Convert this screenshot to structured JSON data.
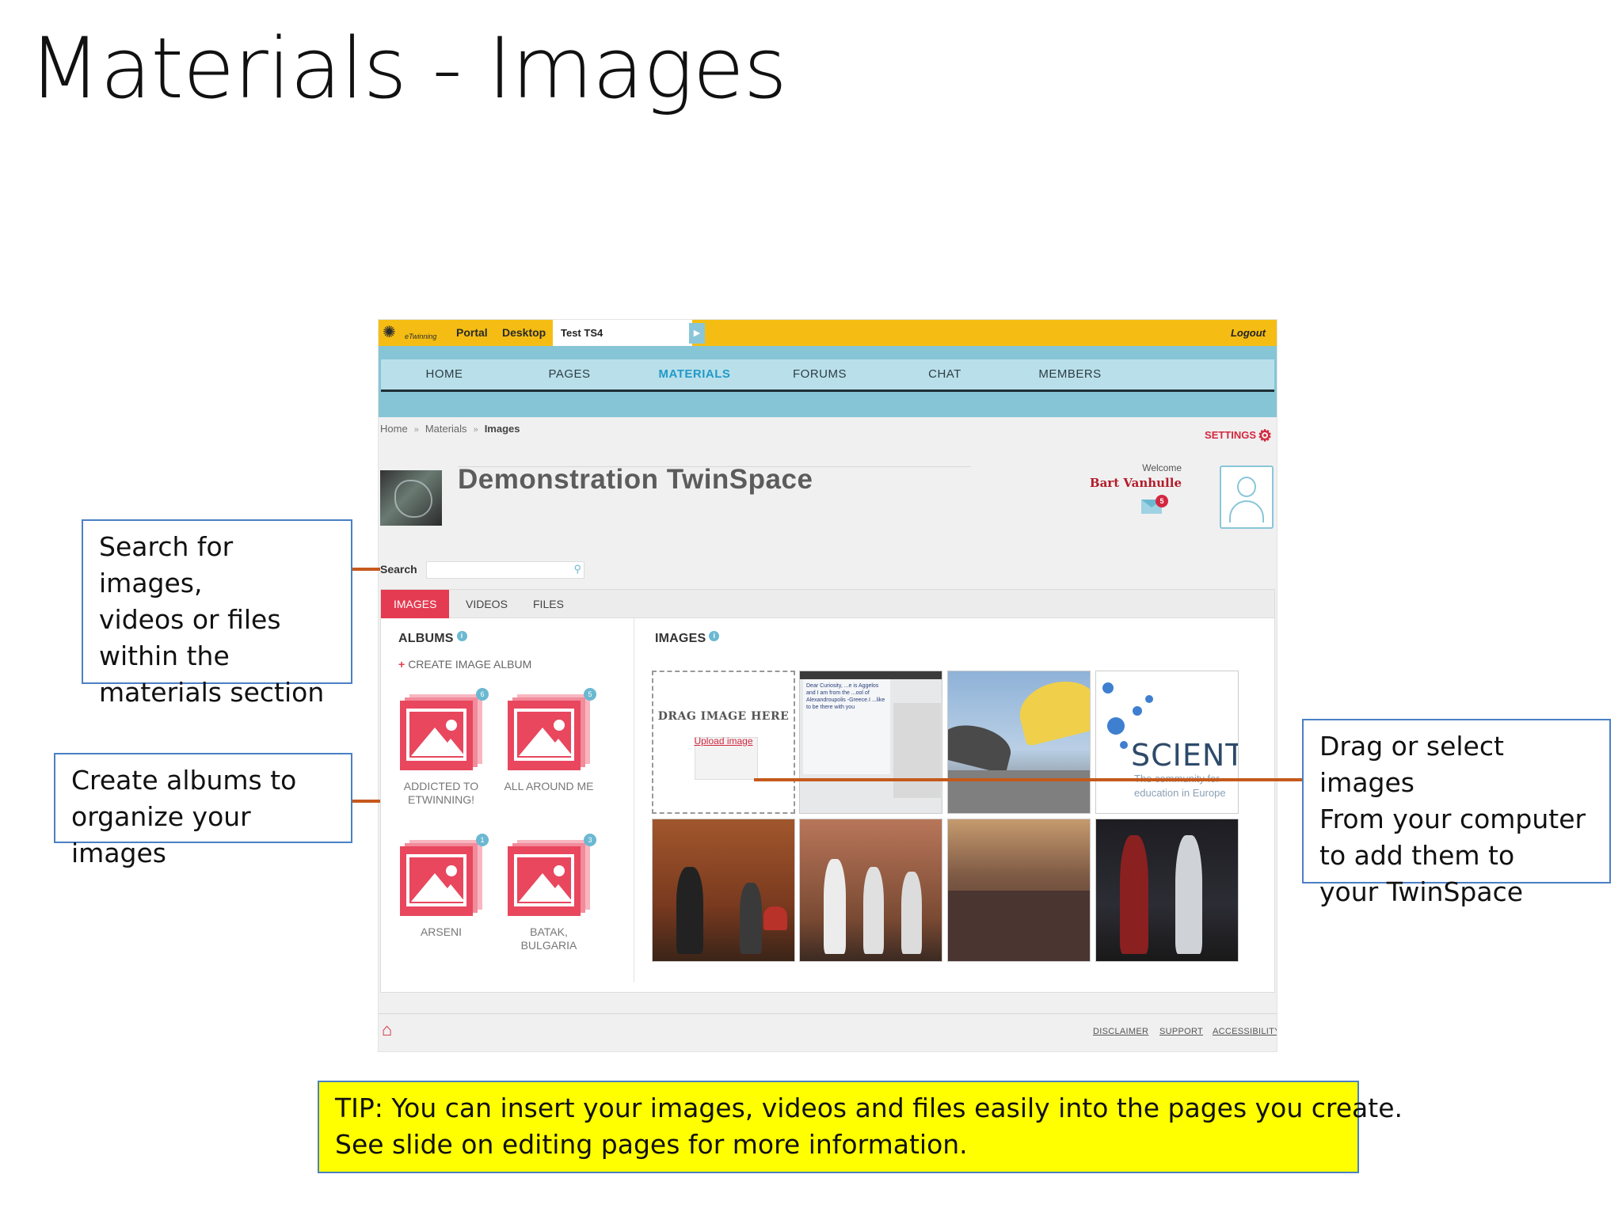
{
  "slide": {
    "title": "Materials - Images"
  },
  "topbar": {
    "brand": "eTwinning",
    "portal": "Portal",
    "desktop": "Desktop",
    "active_tab": "Test TS4",
    "logout": "Logout"
  },
  "nav": {
    "items": [
      "HOME",
      "PAGES",
      "MATERIALS",
      "FORUMS",
      "CHAT",
      "MEMBERS"
    ],
    "active": "MATERIALS"
  },
  "breadcrumb": {
    "home": "Home",
    "materials": "Materials",
    "current": "Images",
    "sep": "»"
  },
  "settings_label": "SETTINGS",
  "space": {
    "title": "Demonstration TwinSpace"
  },
  "user": {
    "welcome": "Welcome",
    "name": "Bart Vanhulle",
    "messages": "5"
  },
  "search": {
    "label": "Search",
    "value": ""
  },
  "tabs": [
    "IMAGES",
    "VIDEOS",
    "FILES"
  ],
  "albums": {
    "heading": "ALBUMS",
    "create": "CREATE IMAGE ALBUM",
    "items": [
      {
        "name": "ADDICTED TO ETWINNING!",
        "count": "6"
      },
      {
        "name": "ALL AROUND ME",
        "count": "5"
      },
      {
        "name": "ARSENI",
        "count": "1"
      },
      {
        "name": "BATAK, BULGARIA",
        "count": "3"
      }
    ]
  },
  "images": {
    "heading": "IMAGES",
    "drop_text": "DRAG IMAGE HERE",
    "upload_link": "Upload image",
    "science_word": "SCIENT",
    "science_sub1": "The community for",
    "science_sub2": "education in Europe",
    "note_text": "Dear Curiosity, ...e is Aggelos and I am from the ...ool of Alexandroupolis -Greece.I ...like to be there with you"
  },
  "footer": {
    "links": [
      "DISCLAIMER",
      "SUPPORT",
      "ACCESSIBILITY"
    ]
  },
  "callouts": {
    "search": [
      "Search for images,",
      "videos or files",
      "within the",
      "materials section"
    ],
    "albums": [
      "Create albums to",
      "organize your images"
    ],
    "drag": [
      "Drag or select images",
      "From your computer",
      "to add them to",
      "your TwinSpace"
    ]
  },
  "tip": {
    "line1": "TIP: You can insert your images, videos and files easily into the pages you create.",
    "line2": "See slide on editing pages for more information."
  },
  "colors": {
    "topbar": "#f5bd13",
    "nav": "#86c5d6",
    "accent_red": "#e43b52",
    "callout_border": "#4a80c4",
    "connector": "#c5591c",
    "tip_bg": "#ffff00"
  }
}
